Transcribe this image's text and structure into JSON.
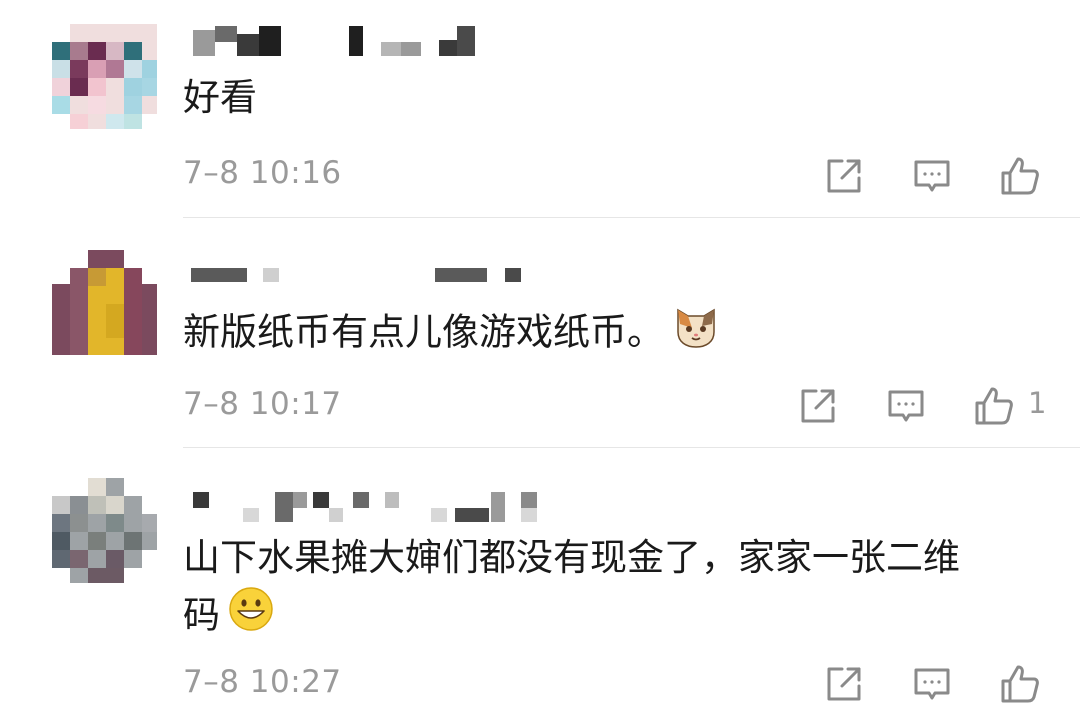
{
  "comments": [
    {
      "text": "好看",
      "time": "7–8 10:16",
      "likes": ""
    },
    {
      "text": "新版纸币有点儿像游戏纸币。",
      "emoji": "cat-face-emoji",
      "time": "7–8 10:17",
      "likes": "1"
    },
    {
      "text_line1": "山下水果摊大婶们都没有现金了，家家一张二维",
      "text_line2": "码",
      "emoji": "grinning-face-emoji",
      "time": "7–8 10:27",
      "likes": ""
    }
  ],
  "icons": {
    "share": "share-icon",
    "reply": "comment-icon",
    "like": "thumbs-up-icon"
  },
  "colors": {
    "text": "#1a1a1a",
    "meta": "#9a9a9a",
    "icon": "#8a8a8a",
    "divider": "#e6e6e6"
  }
}
